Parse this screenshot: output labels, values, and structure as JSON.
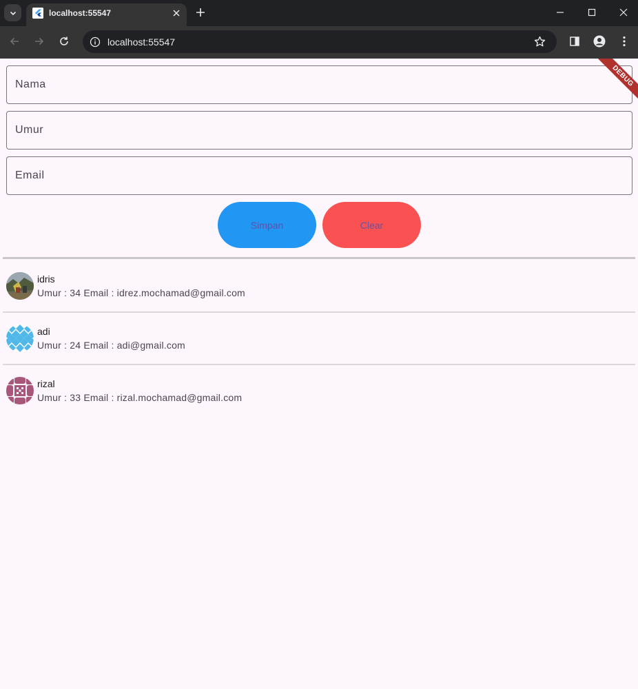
{
  "browser": {
    "tab_title": "localhost:55547",
    "url": "localhost:55547"
  },
  "form": {
    "fields": [
      {
        "label": "Nama"
      },
      {
        "label": "Umur"
      },
      {
        "label": "Email"
      }
    ],
    "save_label": "Simpan",
    "clear_label": "Clear"
  },
  "list": [
    {
      "name": "idris",
      "detail": "Umur : 34 Email : idrez.mochamad@gmail.com",
      "avatar": "photo-avatar"
    },
    {
      "name": "adi",
      "detail": "Umur : 24 Email : adi@gmail.com",
      "avatar": "blue-diamond-pattern-avatar"
    },
    {
      "name": "rizal",
      "detail": "Umur : 33 Email : rizal.mochamad@gmail.com",
      "avatar": "pink-quilt-pattern-avatar"
    }
  ],
  "debug_banner": "DEBUG",
  "colors": {
    "simpan_button": "#2196f3",
    "clear_button": "#fa5252",
    "button_text": "#6750a4",
    "background": "#fdf7fd"
  }
}
